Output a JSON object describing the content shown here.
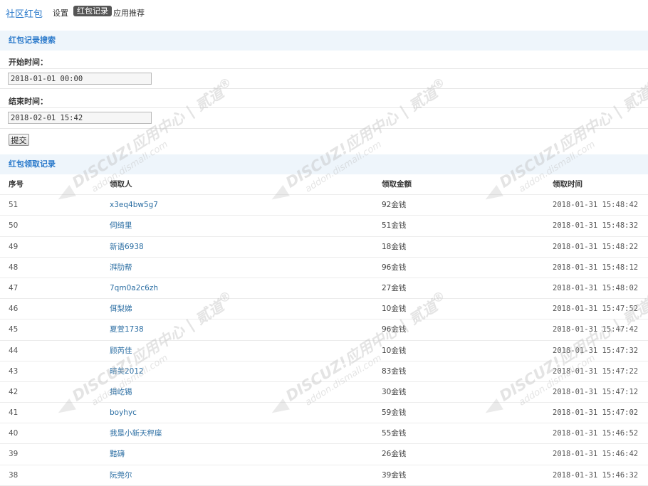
{
  "nav": {
    "brand": "社区红包",
    "items": [
      "设置",
      "红包记录",
      "应用推荐"
    ]
  },
  "search": {
    "heading": "红包记录搜索",
    "start_label": "开始时间：",
    "start_value": "2018-01-01 00:00",
    "end_label": "结束时间：",
    "end_value": "2018-02-01 15:42",
    "submit_label": "提交"
  },
  "records": {
    "heading": "红包领取记录",
    "columns": [
      "序号",
      "领取人",
      "领取金额",
      "领取时间"
    ],
    "rows": [
      {
        "id": "51",
        "user": "x3eq4bw5g7",
        "amount": "92金钱",
        "time": "2018-01-31 15:48:42"
      },
      {
        "id": "50",
        "user": "伺绮里",
        "amount": "51金钱",
        "time": "2018-01-31 15:48:32"
      },
      {
        "id": "49",
        "user": "新语6938",
        "amount": "18金钱",
        "time": "2018-01-31 15:48:22"
      },
      {
        "id": "48",
        "user": "湃肋帮",
        "amount": "96金钱",
        "time": "2018-01-31 15:48:12"
      },
      {
        "id": "47",
        "user": "7qm0a2c6zh",
        "amount": "27金钱",
        "time": "2018-01-31 15:48:02"
      },
      {
        "id": "46",
        "user": "佴梨娣",
        "amount": "10金钱",
        "time": "2018-01-31 15:47:52"
      },
      {
        "id": "45",
        "user": "夏萱1738",
        "amount": "96金钱",
        "time": "2018-01-31 15:47:42"
      },
      {
        "id": "44",
        "user": "顾芮佳",
        "amount": "10金钱",
        "time": "2018-01-31 15:47:32"
      },
      {
        "id": "43",
        "user": "晴美2012",
        "amount": "83金钱",
        "time": "2018-01-31 15:47:22"
      },
      {
        "id": "42",
        "user": "揖屹锡",
        "amount": "30金钱",
        "time": "2018-01-31 15:47:12"
      },
      {
        "id": "41",
        "user": "boyhyc",
        "amount": "59金钱",
        "time": "2018-01-31 15:47:02"
      },
      {
        "id": "40",
        "user": "我是小新天秤座",
        "amount": "55金钱",
        "time": "2018-01-31 15:46:52"
      },
      {
        "id": "39",
        "user": "黠礴",
        "amount": "26金钱",
        "time": "2018-01-31 15:46:42"
      },
      {
        "id": "38",
        "user": "阮莞尔",
        "amount": "39金钱",
        "time": "2018-01-31 15:46:32"
      }
    ]
  },
  "watermark": {
    "line1": "DISCUZ!应用中心 | 贰道",
    "line2": "addon.dismall.com",
    "registered": "®"
  }
}
